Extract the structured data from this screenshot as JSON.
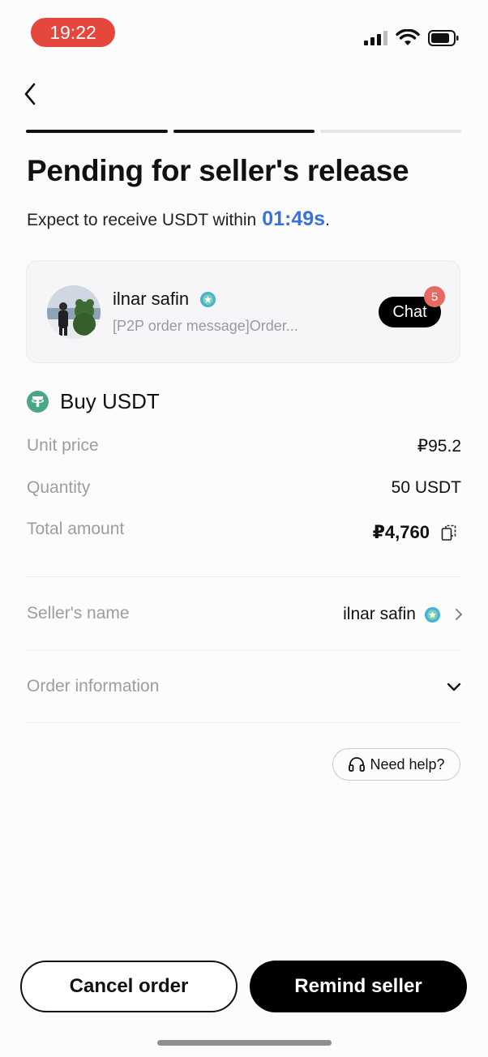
{
  "status_bar": {
    "time": "19:22"
  },
  "header": {
    "title": "Pending for seller's release",
    "subtitle_prefix": "Expect to receive USDT within",
    "timer": "01:49s",
    "subtitle_suffix": "."
  },
  "counterparty_card": {
    "name": "ilnar safin",
    "last_message": "[P2P order message]Order...",
    "chat_label": "Chat",
    "unread_count": "5"
  },
  "order": {
    "title": "Buy USDT",
    "rows": [
      {
        "label": "Unit price",
        "value": "₽95.2"
      },
      {
        "label": "Quantity",
        "value": "50 USDT"
      },
      {
        "label": "Total amount",
        "value": "₽4,760"
      }
    ],
    "seller_label": "Seller's name",
    "seller_value": "ilnar safin",
    "order_info_label": "Order information"
  },
  "help_label": "Need help?",
  "actions": {
    "cancel": "Cancel order",
    "remind": "Remind seller"
  },
  "progress": {
    "steps_total": 3,
    "steps_completed": 2
  },
  "colors": {
    "accent_blue": "#3a72dc",
    "usdt_green": "#4aa785",
    "badge_red": "#e76a62",
    "time_pill": "#e5473d",
    "verified": "#4ab0d8"
  },
  "icons": [
    "back-chevron-icon",
    "signal-icon",
    "wifi-icon",
    "battery-icon",
    "verified-badge-icon",
    "tether-coin-icon",
    "copy-icon",
    "chevron-right-icon",
    "chevron-down-icon",
    "headset-icon"
  ]
}
